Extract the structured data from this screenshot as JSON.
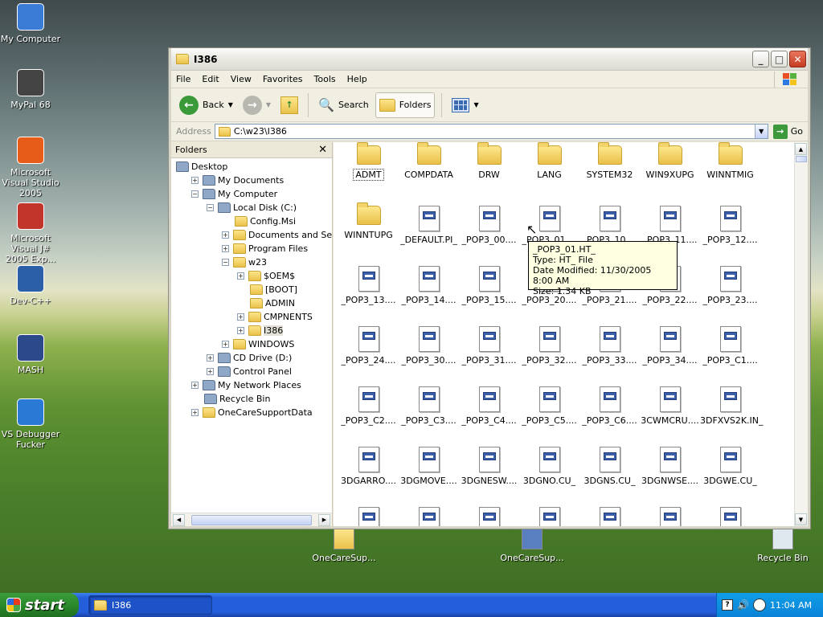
{
  "desktop": {
    "icons": [
      {
        "label": "My Computer",
        "icon": "my-computer-icon"
      },
      {
        "label": "MyPal 68",
        "icon": "mypal-icon"
      },
      {
        "label": "Microsoft Visual Studio 2005",
        "icon": "visual-studio-icon"
      },
      {
        "label": "Microsoft Visual J# 2005 Exp...",
        "icon": "visual-jsharp-icon"
      },
      {
        "label": "Dev-C++",
        "icon": "dev-cpp-icon"
      },
      {
        "label": "MASH",
        "icon": "mash-icon"
      },
      {
        "label": "VS Debugger Fucker",
        "icon": "vs-debugger-icon"
      }
    ],
    "bottom_icons": [
      {
        "label": "OneCareSup...",
        "icon": "folder-icon"
      },
      {
        "label": "OneCareSup...",
        "icon": "onecare-icon"
      },
      {
        "label": "Recycle Bin",
        "icon": "recycle-bin-icon"
      }
    ]
  },
  "window": {
    "title": "I386",
    "menu": [
      "File",
      "Edit",
      "View",
      "Favorites",
      "Tools",
      "Help"
    ],
    "toolbar": {
      "back": "Back",
      "search": "Search",
      "folders": "Folders"
    },
    "address": {
      "label": "Address",
      "value": "C:\\w23\\I386",
      "go": "Go"
    },
    "folders_pane": {
      "title": "Folders",
      "tree": [
        {
          "label": "Desktop",
          "level": 0,
          "expander": "",
          "icon": "desktop-icon"
        },
        {
          "label": "My Documents",
          "level": 1,
          "expander": "+",
          "icon": "my-documents-icon"
        },
        {
          "label": "My Computer",
          "level": 1,
          "expander": "−",
          "icon": "my-computer-icon"
        },
        {
          "label": "Local Disk (C:)",
          "level": 2,
          "expander": "−",
          "icon": "drive-icon"
        },
        {
          "label": "Config.Msi",
          "level": 3,
          "expander": "",
          "icon": "folder-icon"
        },
        {
          "label": "Documents and Settings",
          "level": 3,
          "expander": "+",
          "icon": "folder-icon"
        },
        {
          "label": "Program Files",
          "level": 3,
          "expander": "+",
          "icon": "folder-icon"
        },
        {
          "label": "w23",
          "level": 3,
          "expander": "−",
          "icon": "folder-icon"
        },
        {
          "label": "$OEM$",
          "level": 4,
          "expander": "+",
          "icon": "folder-icon"
        },
        {
          "label": "[BOOT]",
          "level": 4,
          "expander": "",
          "icon": "folder-icon"
        },
        {
          "label": "ADMIN",
          "level": 4,
          "expander": "",
          "icon": "folder-icon"
        },
        {
          "label": "CMPNENTS",
          "level": 4,
          "expander": "+",
          "icon": "folder-icon"
        },
        {
          "label": "I386",
          "level": 4,
          "expander": "+",
          "icon": "folder-icon",
          "selected": true
        },
        {
          "label": "WINDOWS",
          "level": 3,
          "expander": "+",
          "icon": "folder-icon"
        },
        {
          "label": "CD Drive (D:)",
          "level": 2,
          "expander": "+",
          "icon": "cd-drive-icon"
        },
        {
          "label": "Control Panel",
          "level": 2,
          "expander": "+",
          "icon": "control-panel-icon"
        },
        {
          "label": "My Network Places",
          "level": 1,
          "expander": "+",
          "icon": "network-places-icon"
        },
        {
          "label": "Recycle Bin",
          "level": 1,
          "expander": "",
          "icon": "recycle-bin-icon"
        },
        {
          "label": "OneCareSupportData",
          "level": 1,
          "expander": "+",
          "icon": "folder-icon"
        }
      ]
    },
    "files": [
      {
        "name": "ADMT",
        "type": "folder"
      },
      {
        "name": "COMPDATA",
        "type": "folder"
      },
      {
        "name": "DRW",
        "type": "folder"
      },
      {
        "name": "LANG",
        "type": "folder"
      },
      {
        "name": "SYSTEM32",
        "type": "folder"
      },
      {
        "name": "WIN9XUPG",
        "type": "folder"
      },
      {
        "name": "WINNTMIG",
        "type": "folder"
      },
      {
        "name": "WINNTUPG",
        "type": "folder"
      },
      {
        "name": "_DEFAULT.PI_",
        "type": "file"
      },
      {
        "name": "_POP3_00....",
        "type": "file"
      },
      {
        "name": "_POP3_01....",
        "type": "file"
      },
      {
        "name": "_POP3_10....",
        "type": "file"
      },
      {
        "name": "_POP3_11....",
        "type": "file"
      },
      {
        "name": "_POP3_12....",
        "type": "file"
      },
      {
        "name": "_POP3_13....",
        "type": "file"
      },
      {
        "name": "_POP3_14....",
        "type": "file"
      },
      {
        "name": "_POP3_15....",
        "type": "file"
      },
      {
        "name": "_POP3_20....",
        "type": "file"
      },
      {
        "name": "_POP3_21....",
        "type": "file"
      },
      {
        "name": "_POP3_22....",
        "type": "file"
      },
      {
        "name": "_POP3_23....",
        "type": "file"
      },
      {
        "name": "_POP3_24....",
        "type": "file"
      },
      {
        "name": "_POP3_30....",
        "type": "file"
      },
      {
        "name": "_POP3_31....",
        "type": "file"
      },
      {
        "name": "_POP3_32....",
        "type": "file"
      },
      {
        "name": "_POP3_33....",
        "type": "file"
      },
      {
        "name": "_POP3_34....",
        "type": "file"
      },
      {
        "name": "_POP3_C1....",
        "type": "file"
      },
      {
        "name": "_POP3_C2....",
        "type": "file"
      },
      {
        "name": "_POP3_C3....",
        "type": "file"
      },
      {
        "name": "_POP3_C4....",
        "type": "file"
      },
      {
        "name": "_POP3_C5....",
        "type": "file"
      },
      {
        "name": "_POP3_C6....",
        "type": "file"
      },
      {
        "name": "3CWMCRU....",
        "type": "file"
      },
      {
        "name": "3DFXVS2K.IN_",
        "type": "file"
      },
      {
        "name": "3DGARRO....",
        "type": "file"
      },
      {
        "name": "3DGMOVE....",
        "type": "file"
      },
      {
        "name": "3DGNESW....",
        "type": "file"
      },
      {
        "name": "3DGNO.CU_",
        "type": "file"
      },
      {
        "name": "3DGNS.CU_",
        "type": "file"
      },
      {
        "name": "3DGNWSE....",
        "type": "file"
      },
      {
        "name": "3DGWE.CU_",
        "type": "file"
      },
      {
        "name": "",
        "type": "file"
      },
      {
        "name": "",
        "type": "file"
      },
      {
        "name": "",
        "type": "file"
      },
      {
        "name": "",
        "type": "file"
      },
      {
        "name": "",
        "type": "file"
      },
      {
        "name": "",
        "type": "file"
      },
      {
        "name": "",
        "type": "file"
      }
    ],
    "tooltip": {
      "name": "_POP3_01.HT_",
      "type": "Type: HT_ File",
      "modified": "Date Modified: 11/30/2005 8:00 AM",
      "size": "Size: 1.34 KB"
    }
  },
  "taskbar": {
    "start": "start",
    "task": "I386",
    "clock": "11:04 AM"
  }
}
